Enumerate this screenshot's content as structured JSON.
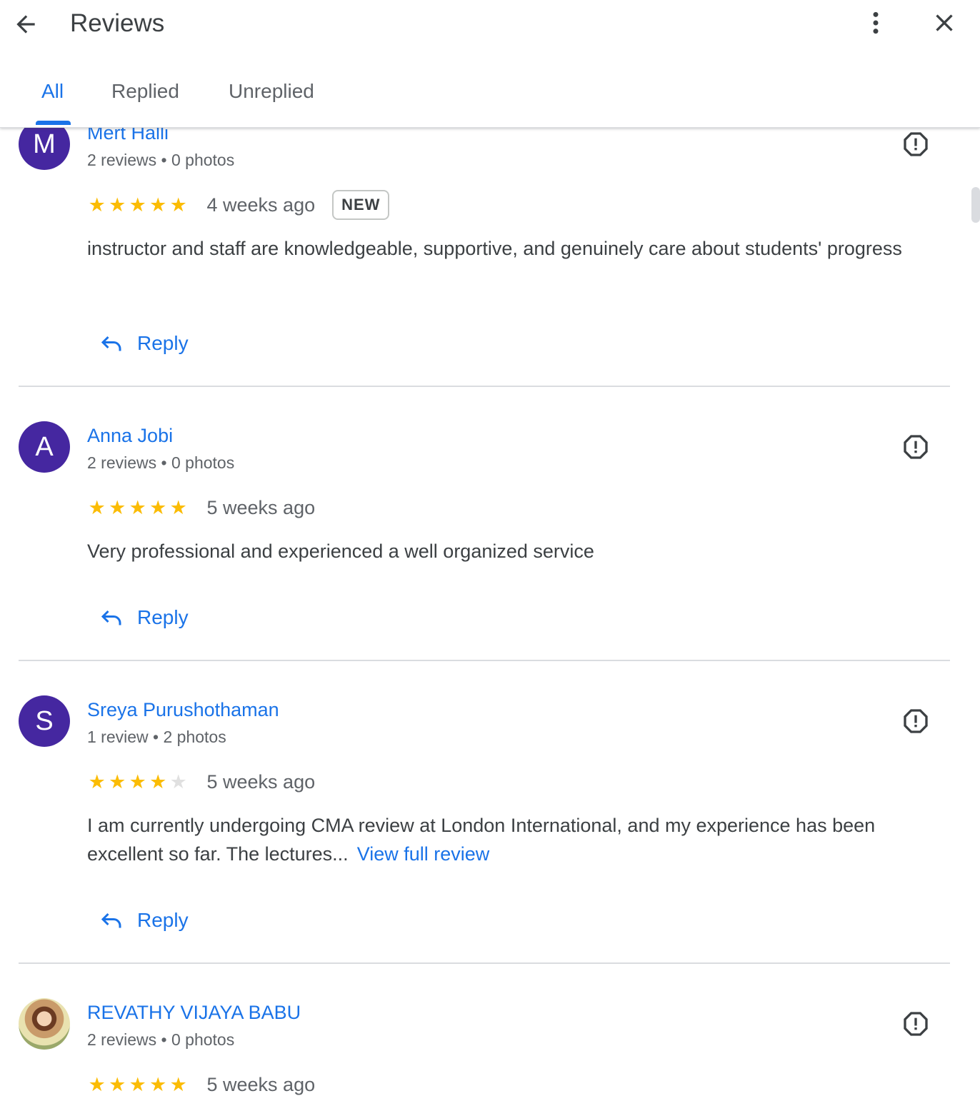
{
  "header": {
    "title": "Reviews",
    "back_icon": "arrow-back-icon",
    "more_icon": "more-vert-icon",
    "close_icon": "close-icon"
  },
  "tabs": [
    {
      "label": "All",
      "active": true
    },
    {
      "label": "Replied",
      "active": false
    },
    {
      "label": "Unreplied",
      "active": false
    }
  ],
  "reviews": [
    {
      "initial": "M",
      "name": "Mert Halli",
      "meta": "2 reviews • 0 photos",
      "rating": 5,
      "when": "4 weeks ago",
      "badge": "NEW",
      "text": "instructor and staff are knowledgeable, supportive, and genuinely care about students' progress",
      "reply_label": "Reply"
    },
    {
      "initial": "A",
      "name": "Anna Jobi",
      "meta": "2 reviews • 0 photos",
      "rating": 5,
      "when": "5 weeks ago",
      "text": "Very professional and experienced a well organized service",
      "reply_label": "Reply"
    },
    {
      "initial": "S",
      "name": "Sreya Purushothaman",
      "meta": "1 review • 2 photos",
      "rating": 4,
      "when": "5 weeks ago",
      "text": "I am currently undergoing CMA review at London International, and my experience has been excellent so far. The lectures...",
      "more_link": "View full review",
      "reply_label": "Reply"
    },
    {
      "name": "REVATHY VIJAYA BABU",
      "meta": "2 reviews • 0 photos",
      "rating": 5,
      "when": "5 weeks ago"
    }
  ],
  "colors": {
    "accent": "#1a73e8",
    "avatar": "#4527a0",
    "star": "#fbbc04",
    "star_empty": "#e0e0e0"
  }
}
